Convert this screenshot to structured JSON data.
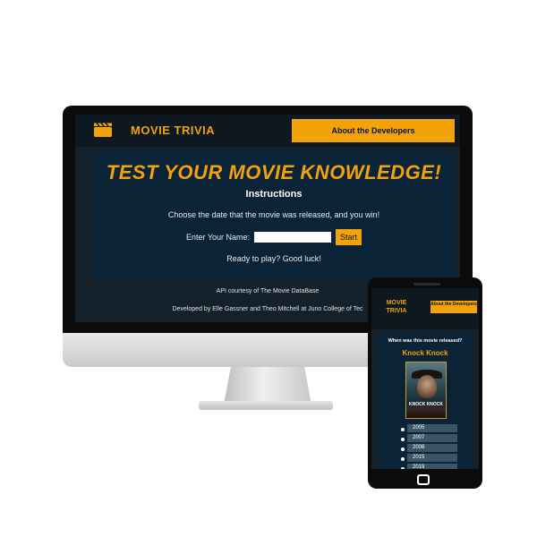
{
  "colors": {
    "accent": "#f2a20b",
    "background": "#14202a",
    "panel": "#0b2336",
    "header": "#0d1820",
    "option_bg": "#3c5566"
  },
  "desktop": {
    "header": {
      "icon": "clapperboard-icon",
      "title": "MOVIE TRIVIA",
      "about_button": "About the Developers"
    },
    "main": {
      "headline": "TEST YOUR MOVIE KNOWLEDGE!",
      "instructions_title": "Instructions",
      "instructions_text": "Choose the date that the movie was released, and you win!",
      "name_label": "Enter Your Name:",
      "name_value": "",
      "start_button": "Start",
      "ready_text": "Ready to play? Good luck!"
    },
    "footer": {
      "api_credit": "API courtesy of The Movie DataBase",
      "dev_credit": "Developed by Elle Gassner and Theo Mitchell at Juno College of Tec"
    }
  },
  "mobile": {
    "header": {
      "title": "MOVIE TRIVIA",
      "about_button": "About the Developers"
    },
    "question": "When was this movie released?",
    "movie_title": "Knock Knock",
    "poster_title": "KNOCK KNOCK",
    "options": [
      "2005",
      "2007",
      "2008",
      "2015",
      "2019"
    ]
  }
}
